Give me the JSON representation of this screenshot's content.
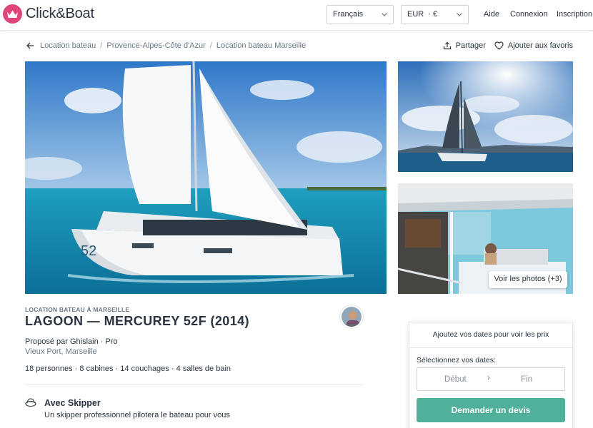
{
  "brand": {
    "name": "Click&Boat",
    "accent": "#e0457b",
    "cta_color": "#4fb09b"
  },
  "header": {
    "language": "Français",
    "currency": "EUR  · €",
    "nav": [
      "Aide",
      "Connexion",
      "Inscription"
    ]
  },
  "breadcrumb": {
    "items": [
      "Location bateau",
      "Provence-Alpes-Côte d'Azur",
      "Location bateau Marseille"
    ],
    "separator": "/"
  },
  "actions": {
    "share": "Partager",
    "favorite": "Ajouter aux favoris"
  },
  "gallery": {
    "see_photos": "Voir les photos (+3)",
    "hull_number": "52"
  },
  "listing": {
    "kicker": "LOCATION BATEAU À MARSEILLE",
    "title": "LAGOON — MERCUREY 52F (2014)",
    "owner": "Proposé par Ghislain · Pro",
    "location": "Vieux Port, Marseille",
    "specs": "18 personnes · 8 cabines · 14 couchages · 4 salles de bain",
    "skipper_title": "Avec Skipper",
    "skipper_desc": "Un skipper professionnel pilotera le bateau pour vous"
  },
  "booking": {
    "header": "Ajoutez vos dates pour voir les prix",
    "label": "Sélectionnez vos dates:",
    "start_placeholder": "Début",
    "end_placeholder": "Fin",
    "arrow": "›",
    "cta": "Demander un devis"
  }
}
